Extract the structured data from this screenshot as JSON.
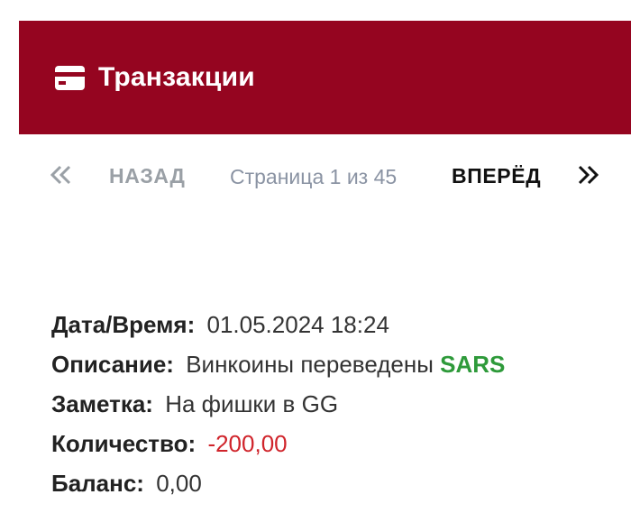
{
  "header": {
    "title": "Транзакции",
    "icon": "credit-card-icon",
    "background": "#950520"
  },
  "pager": {
    "prev_icon": "double-chevron-left-icon",
    "prev_label": "НАЗАД",
    "page_info": "Страница 1 из 45",
    "next_label": "ВПЕРЁД",
    "next_icon": "double-chevron-right-icon"
  },
  "transaction": {
    "datetime_label": "Дата/Время:",
    "datetime_value": "01.05.2024 18:24",
    "description_label": "Описание:",
    "description_text": "Винкоины переведены",
    "description_recipient": "SARS",
    "note_label": "Заметка:",
    "note_value": "На фишки в GG",
    "amount_label": "Количество:",
    "amount_value": "-200,00",
    "balance_label": "Баланс:",
    "balance_value": "0,00"
  },
  "colors": {
    "recipient": "#2e9a3a",
    "negative_amount": "#d0242b"
  }
}
